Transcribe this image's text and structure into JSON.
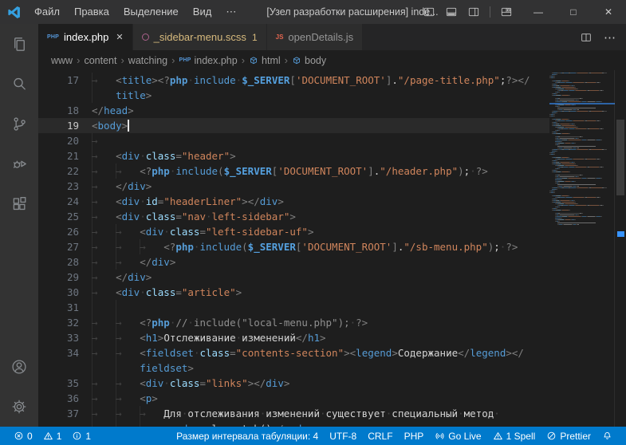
{
  "colors": {
    "accent": "#007acc",
    "titlebar_bg": "#323233",
    "editor_bg": "#1e1e1e",
    "tab_warning": "#d7ba7d",
    "info_marker": "#3794ff"
  },
  "titlebar": {
    "title": "[Узел разработки расширения] inde...",
    "menu_items": [
      "Файл",
      "Правка",
      "Выделение",
      "Вид",
      "⋯"
    ],
    "layout_icons": [
      "toggle-primary-sidebar-icon",
      "toggle-panel-icon",
      "toggle-secondary-sidebar-icon",
      "customize-layout-icon"
    ],
    "window_buttons": [
      {
        "name": "minimize-button",
        "glyph": "—"
      },
      {
        "name": "maximize-button",
        "glyph": "□"
      },
      {
        "name": "close-button",
        "glyph": "✕"
      }
    ]
  },
  "activity_bar": {
    "top": [
      "explorer",
      "search",
      "source-control",
      "run-debug",
      "extensions"
    ],
    "bottom": [
      "accounts",
      "settings"
    ]
  },
  "tabs": [
    {
      "label": "index.php",
      "icon": "php",
      "active": true,
      "closable": true,
      "close_glyph": "✕"
    },
    {
      "label": "_sidebar-menu.scss",
      "icon": "sass",
      "badge": "1",
      "state": "warning"
    },
    {
      "label": "openDetails.js",
      "icon": "js"
    }
  ],
  "editor_actions": [
    "split-editor-icon",
    "more-actions-icon"
  ],
  "breadcrumbs": [
    {
      "label": "www"
    },
    {
      "label": "content"
    },
    {
      "label": "watching"
    },
    {
      "label": "index.php",
      "icon": "php"
    },
    {
      "label": "html",
      "icon": "symbol"
    },
    {
      "label": "body",
      "icon": "symbol"
    }
  ],
  "editor": {
    "cursor_line": "19",
    "lines": [
      {
        "num": "17",
        "rows": [
          {
            "indent": 1,
            "segs": [
              [
                "p",
                "<"
              ],
              [
                "t",
                "title"
              ],
              [
                "p",
                ">"
              ],
              [
                "p",
                "<?"
              ],
              [
                "kb",
                "php"
              ],
              [
                "x",
                " "
              ],
              [
                "k",
                "include"
              ],
              [
                "x",
                " "
              ],
              [
                "v",
                "$_SERVER"
              ],
              [
                "p",
                "["
              ],
              [
                "s",
                "'DOCUMENT_ROOT'"
              ],
              [
                "p",
                "]"
              ],
              [
                "x",
                "."
              ],
              [
                "s",
                "\"/page-title.php\""
              ],
              [
                "x",
                ";"
              ],
              [
                "p",
                "?>"
              ],
              [
                "p",
                "</"
              ]
            ]
          },
          {
            "indent": 1,
            "wrap": true,
            "segs": [
              [
                "t",
                "title"
              ],
              [
                "p",
                ">"
              ]
            ]
          }
        ]
      },
      {
        "num": "18",
        "rows": [
          {
            "indent": 0,
            "segs": [
              [
                "p",
                "</"
              ],
              [
                "t",
                "head"
              ],
              [
                "p",
                ">"
              ]
            ]
          }
        ]
      },
      {
        "num": "19",
        "cursor": true,
        "rows": [
          {
            "indent": 0,
            "segs": [
              [
                "p",
                "<"
              ],
              [
                "t",
                "body"
              ],
              [
                "p",
                ">"
              ]
            ]
          }
        ]
      },
      {
        "num": "20",
        "rows": [
          {
            "indent": 1,
            "segs": []
          }
        ]
      },
      {
        "num": "21",
        "rows": [
          {
            "indent": 1,
            "segs": [
              [
                "p",
                "<"
              ],
              [
                "t",
                "div"
              ],
              [
                "x",
                " "
              ],
              [
                "a",
                "class"
              ],
              [
                "p",
                "="
              ],
              [
                "s",
                "\"header\""
              ],
              [
                "p",
                ">"
              ]
            ]
          }
        ]
      },
      {
        "num": "22",
        "rows": [
          {
            "indent": 2,
            "segs": [
              [
                "p",
                "<?"
              ],
              [
                "kb",
                "php"
              ],
              [
                "x",
                " "
              ],
              [
                "k",
                "include"
              ],
              [
                "p",
                "("
              ],
              [
                "v",
                "$_SERVER"
              ],
              [
                "p",
                "["
              ],
              [
                "s",
                "'DOCUMENT_ROOT'"
              ],
              [
                "p",
                "]"
              ],
              [
                "x",
                "."
              ],
              [
                "s",
                "\"/header.php\""
              ],
              [
                "p",
                ")"
              ],
              [
                "x",
                "; "
              ],
              [
                "p",
                "?>"
              ]
            ]
          }
        ]
      },
      {
        "num": "23",
        "rows": [
          {
            "indent": 1,
            "segs": [
              [
                "p",
                "</"
              ],
              [
                "t",
                "div"
              ],
              [
                "p",
                ">"
              ]
            ]
          }
        ]
      },
      {
        "num": "24",
        "rows": [
          {
            "indent": 1,
            "segs": [
              [
                "p",
                "<"
              ],
              [
                "t",
                "div"
              ],
              [
                "x",
                " "
              ],
              [
                "a",
                "id"
              ],
              [
                "p",
                "="
              ],
              [
                "s",
                "\"headerLiner\""
              ],
              [
                "p",
                "></"
              ],
              [
                "t",
                "div"
              ],
              [
                "p",
                ">"
              ]
            ]
          }
        ]
      },
      {
        "num": "25",
        "rows": [
          {
            "indent": 1,
            "segs": [
              [
                "p",
                "<"
              ],
              [
                "t",
                "div"
              ],
              [
                "x",
                " "
              ],
              [
                "a",
                "class"
              ],
              [
                "p",
                "="
              ],
              [
                "s",
                "\"nav left-sidebar\""
              ],
              [
                "p",
                ">"
              ]
            ]
          }
        ]
      },
      {
        "num": "26",
        "rows": [
          {
            "indent": 2,
            "segs": [
              [
                "p",
                "<"
              ],
              [
                "t",
                "div"
              ],
              [
                "x",
                " "
              ],
              [
                "a",
                "class"
              ],
              [
                "p",
                "="
              ],
              [
                "s",
                "\"left-sidebar-uf\""
              ],
              [
                "p",
                ">"
              ]
            ]
          }
        ]
      },
      {
        "num": "27",
        "rows": [
          {
            "indent": 3,
            "segs": [
              [
                "p",
                "<?"
              ],
              [
                "kb",
                "php"
              ],
              [
                "x",
                " "
              ],
              [
                "k",
                "include"
              ],
              [
                "p",
                "("
              ],
              [
                "v",
                "$_SERVER"
              ],
              [
                "p",
                "["
              ],
              [
                "s",
                "'DOCUMENT_ROOT'"
              ],
              [
                "p",
                "]"
              ],
              [
                "x",
                "."
              ],
              [
                "s",
                "\"/sb-menu.php\""
              ],
              [
                "p",
                ")"
              ],
              [
                "x",
                "; "
              ],
              [
                "p",
                "?>"
              ]
            ]
          }
        ]
      },
      {
        "num": "28",
        "rows": [
          {
            "indent": 2,
            "segs": [
              [
                "p",
                "</"
              ],
              [
                "t",
                "div"
              ],
              [
                "p",
                ">"
              ]
            ]
          }
        ]
      },
      {
        "num": "29",
        "rows": [
          {
            "indent": 1,
            "segs": [
              [
                "p",
                "</"
              ],
              [
                "t",
                "div"
              ],
              [
                "p",
                ">"
              ]
            ]
          }
        ]
      },
      {
        "num": "30",
        "rows": [
          {
            "indent": 1,
            "segs": [
              [
                "p",
                "<"
              ],
              [
                "t",
                "div"
              ],
              [
                "x",
                " "
              ],
              [
                "a",
                "class"
              ],
              [
                "p",
                "="
              ],
              [
                "s",
                "\"article\""
              ],
              [
                "p",
                ">"
              ]
            ]
          }
        ]
      },
      {
        "num": "31",
        "rows": [
          {
            "indent": 0,
            "guides": 2,
            "segs": []
          }
        ]
      },
      {
        "num": "32",
        "rows": [
          {
            "indent": 2,
            "segs": [
              [
                "p",
                "<?"
              ],
              [
                "kb",
                "php"
              ],
              [
                "x",
                " "
              ],
              [
                "c",
                "// include(\"local-menu.php\");"
              ],
              [
                "x",
                " "
              ],
              [
                "p",
                "?>"
              ]
            ]
          }
        ]
      },
      {
        "num": "33",
        "rows": [
          {
            "indent": 2,
            "segs": [
              [
                "p",
                "<"
              ],
              [
                "t",
                "h1"
              ],
              [
                "p",
                ">"
              ],
              [
                "x",
                "Отслеживание изменений"
              ],
              [
                "p",
                "</"
              ],
              [
                "t",
                "h1"
              ],
              [
                "p",
                ">"
              ]
            ]
          }
        ]
      },
      {
        "num": "34",
        "rows": [
          {
            "indent": 2,
            "segs": [
              [
                "p",
                "<"
              ],
              [
                "t",
                "fieldset"
              ],
              [
                "x",
                " "
              ],
              [
                "a",
                "class"
              ],
              [
                "p",
                "="
              ],
              [
                "s",
                "\"contents-section\""
              ],
              [
                "p",
                "><"
              ],
              [
                "t",
                "legend"
              ],
              [
                "p",
                ">"
              ],
              [
                "x",
                "Содержание"
              ],
              [
                "p",
                "</"
              ],
              [
                "t",
                "legend"
              ],
              [
                "p",
                "></"
              ]
            ]
          },
          {
            "indent": 2,
            "wrap": true,
            "segs": [
              [
                "t",
                "fieldset"
              ],
              [
                "p",
                ">"
              ]
            ]
          }
        ]
      },
      {
        "num": "35",
        "rows": [
          {
            "indent": 2,
            "segs": [
              [
                "p",
                "<"
              ],
              [
                "t",
                "div"
              ],
              [
                "x",
                " "
              ],
              [
                "a",
                "class"
              ],
              [
                "p",
                "="
              ],
              [
                "s",
                "\"links\""
              ],
              [
                "p",
                "></"
              ],
              [
                "t",
                "div"
              ],
              [
                "p",
                ">"
              ]
            ]
          }
        ]
      },
      {
        "num": "36",
        "rows": [
          {
            "indent": 2,
            "segs": [
              [
                "p",
                "<"
              ],
              [
                "t",
                "p"
              ],
              [
                "p",
                ">"
              ]
            ]
          }
        ]
      },
      {
        "num": "37",
        "rows": [
          {
            "indent": 3,
            "segs": [
              [
                "x",
                "Для отслеживания изменений существует специальный метод "
              ]
            ]
          },
          {
            "indent": 3,
            "wrap": true,
            "segs": [
              [
                "p",
                "<"
              ],
              [
                "t",
                "code"
              ],
              [
                "p",
                ">"
              ],
              [
                "x",
                "gulp.watch()"
              ],
              [
                "p",
                "</"
              ],
              [
                "t",
                "code"
              ],
              [
                "p",
                ">"
              ],
              [
                "x",
                ";"
              ]
            ]
          }
        ]
      }
    ]
  },
  "status_bar": {
    "problems": {
      "errors": "0",
      "warnings": "1",
      "infos": "1"
    },
    "right_items": [
      {
        "name": "status-tab-size",
        "label": "Размер интервала табуляции: 4"
      },
      {
        "name": "status-encoding",
        "label": "UTF-8"
      },
      {
        "name": "status-eol",
        "label": "CRLF"
      },
      {
        "name": "status-language",
        "label": "PHP"
      },
      {
        "name": "status-go-live",
        "label": "Go Live",
        "icon": "broadcast"
      },
      {
        "name": "status-spell",
        "label": "1 Spell",
        "icon": "warning"
      },
      {
        "name": "status-prettier",
        "label": "Prettier",
        "icon": "slash"
      },
      {
        "name": "status-notifications",
        "icon": "bell"
      }
    ]
  }
}
